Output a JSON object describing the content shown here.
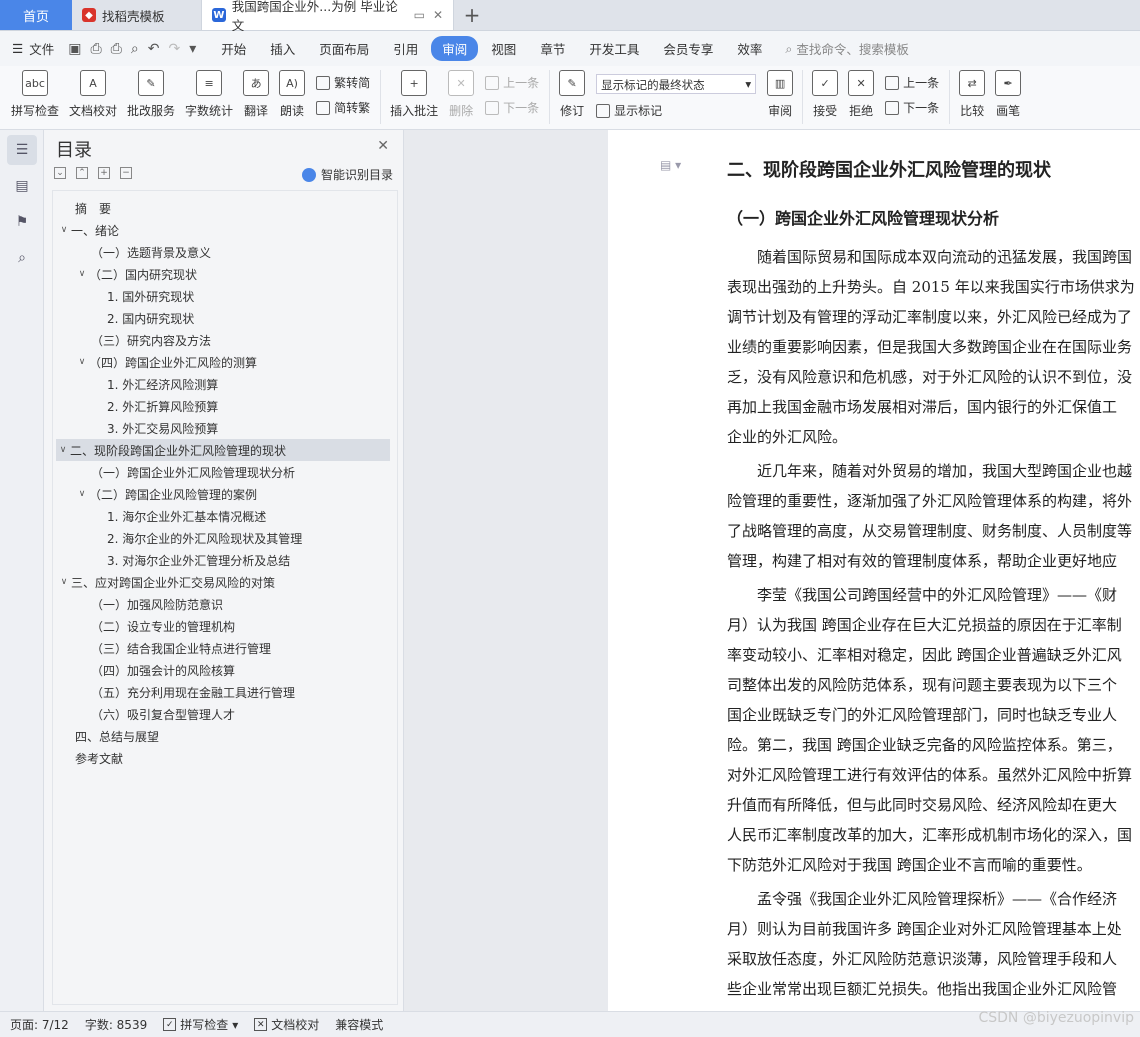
{
  "tabs": {
    "home": "首页",
    "template": "找稻壳模板",
    "document": "我国跨国企业外...为例 毕业论文"
  },
  "menu": {
    "file": "文件",
    "items": [
      "开始",
      "插入",
      "页面布局",
      "引用",
      "审阅",
      "视图",
      "章节",
      "开发工具",
      "会员专享",
      "效率"
    ],
    "active": "审阅",
    "search": "查找命令、搜索模板"
  },
  "ribbon": {
    "spell": "拼写检查",
    "doc_check": "文档校对",
    "review_service": "批改服务",
    "word_count": "字数统计",
    "translate": "翻译",
    "read_aloud": "朗读",
    "trad": "繁转简",
    "simp": "简转繁",
    "insert_comment": "插入批注",
    "delete": "删除",
    "prev": "上一条",
    "next": "下一条",
    "track": "修订",
    "markup_select": "显示标记的最终状态",
    "show_markup": "显示标记",
    "review": "审阅",
    "accept": "接受",
    "reject": "拒绝",
    "prev2": "上一条",
    "next2": "下一条",
    "compare": "比较",
    "pen": "画笔"
  },
  "toc": {
    "title": "目录",
    "smart": "智能识别目录",
    "items": [
      {
        "text": "摘　要"
      },
      {
        "text": "一、绪论"
      },
      {
        "text": "（一）选题背景及意义"
      },
      {
        "text": "（二）国内研究现状"
      },
      {
        "text": "1. 国外研究现状"
      },
      {
        "text": "2. 国内研究现状"
      },
      {
        "text": "（三）研究内容及方法"
      },
      {
        "text": "（四）跨国企业外汇风险的测算"
      },
      {
        "text": "1. 外汇经济风险测算"
      },
      {
        "text": "2. 外汇折算风险预算"
      },
      {
        "text": "3. 外汇交易风险预算"
      },
      {
        "text": "二、现阶段跨国企业外汇风险管理的现状"
      },
      {
        "text": "（一）跨国企业外汇风险管理现状分析"
      },
      {
        "text": "（二）跨国企业风险管理的案例"
      },
      {
        "text": "1. 海尔企业外汇基本情况概述"
      },
      {
        "text": "2. 海尔企业的外汇风险现状及其管理"
      },
      {
        "text": "3. 对海尔企业外汇管理分析及总结"
      },
      {
        "text": "三、应对跨国企业外汇交易风险的对策"
      },
      {
        "text": "（一）加强风险防范意识"
      },
      {
        "text": "（二）设立专业的管理机构"
      },
      {
        "text": "（三）结合我国企业特点进行管理"
      },
      {
        "text": "（四）加强会计的风险核算"
      },
      {
        "text": "（五）充分利用现在金融工具进行管理"
      },
      {
        "text": "（六）吸引复合型管理人才"
      },
      {
        "text": "四、总结与展望"
      },
      {
        "text": "参考文献"
      }
    ]
  },
  "doc": {
    "h2": "二、现阶段跨国企业外汇风险管理的现状",
    "h3": "（一）跨国企业外汇风险管理现状分析",
    "lines": [
      "　　随着国际贸易和国际成本双向流动的迅猛发展，我国跨国",
      "表现出强劲的上升势头。自 2015 年以来我国实行市场供求为",
      "调节计划及有管理的浮动汇率制度以来，外汇风险已经成为了",
      "业绩的重要影响因素，但是我国大多数跨国企业在在国际业务",
      "乏，没有风险意识和危机感，对于外汇风险的认识不到位，没",
      "再加上我国金融市场发展相对滞后，国内银行的外汇保值工",
      "企业的外汇风险。",
      "　　近几年来，随着对外贸易的增加，我国大型跨国企业也越",
      "险管理的重要性，逐渐加强了外汇风险管理体系的构建，将外",
      "了战略管理的高度，从交易管理制度、财务制度、人员制度等",
      "管理，构建了相对有效的管理制度体系，帮助企业更好地应",
      "　　李莹《我国公司跨国经营中的外汇风险管理》——《财",
      "月）认为我国 跨国企业存在巨大汇兑损益的原因在于汇率制",
      "率变动较小、汇率相对稳定，因此 跨国企业普遍缺乏外汇风",
      "司整体出发的风险防范体系，现有问题主要表现为以下三个",
      "国企业既缺乏专门的外汇风险管理部门，同时也缺乏专业人",
      "险。第二，我国 跨国企业缺乏完备的风险监控体系。第三，",
      "对外汇风险管理工进行有效评估的体系。虽然外汇风险中折算",
      "升值而有所降低，但与此同时交易风险、经济风险却在更大",
      "人民币汇率制度改革的加大，汇率形成机制市场化的深入，国",
      "下防范外汇风险对于我国 跨国企业不言而喻的重要性。",
      "　　孟令强《我国企业外汇风险管理探析》——《合作经济",
      "月）则认为目前我国许多 跨国企业对外汇风险管理基本上处",
      "采取放任态度，外汇风险防范意识淡薄，风险管理手段和人",
      "些企业常常出现巨额汇兑损失。他指出我国企业外汇风险管"
    ]
  },
  "status": {
    "page": "页面: 7/12",
    "words": "字数: 8539",
    "spell": "拼写检查",
    "doc_check": "文档校对",
    "compat": "兼容模式"
  },
  "watermark": "CSDN @biyezuopinvip"
}
